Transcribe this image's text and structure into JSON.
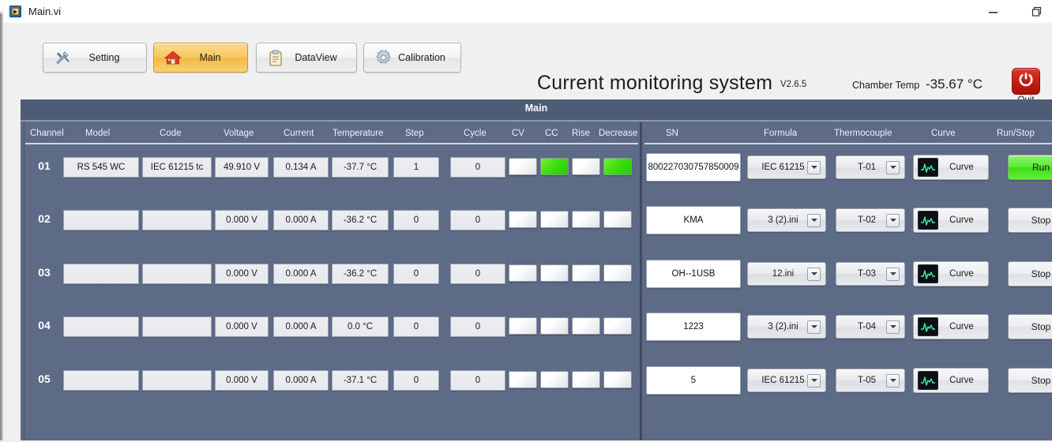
{
  "window": {
    "title": "Main.vi",
    "icon": "labview-vi-icon",
    "controls": [
      {
        "name": "minimize-button",
        "glyph": "minimize-icon"
      },
      {
        "name": "restore-button",
        "glyph": "restore-icon"
      }
    ]
  },
  "toolbar": {
    "buttons": [
      {
        "id": "setting",
        "label": "Setting",
        "icon": "tools-icon",
        "active": false
      },
      {
        "id": "main",
        "label": "Main",
        "icon": "home-icon",
        "active": true
      },
      {
        "id": "dataview",
        "label": "DataView",
        "icon": "clipboard-icon",
        "active": false
      },
      {
        "id": "calibration",
        "label": "Calibration",
        "icon": "gear-icon",
        "active": false
      }
    ],
    "app_title": "Current monitoring system",
    "version": "V2.6.5",
    "chamber_temp_label": "Chamber Temp",
    "chamber_temp_value": "-35.67 °C",
    "quit_label": "Quit",
    "quit_icon": "power-icon",
    "quit_color": "#c21d12",
    "accent_color": "#f4ba42"
  },
  "panel": {
    "header": "Main",
    "left_headers": [
      "Channel",
      "Model",
      "Code",
      "Voltage",
      "Current",
      "Temperature",
      "Step",
      "Cycle",
      "CV",
      "CC",
      "Rise",
      "Decrease"
    ],
    "right_headers": [
      "SN",
      "Formula",
      "Thermocouple",
      "Curve",
      "Run/Stop"
    ],
    "lamp_on_color": "#3fdd15",
    "lamp_off_color": "#ffffff",
    "rows": [
      {
        "channel": "01",
        "model": "RS 545 WC",
        "code": "IEC 61215 tc",
        "voltage": "49.910 V",
        "current": "0.134 A",
        "temperature": "-37.7 °C",
        "step": "1",
        "cycle": "0",
        "cv": false,
        "cc": true,
        "rise": false,
        "decrease": true,
        "sn": "800227030757850009",
        "formula": "IEC 61215",
        "thermocouple": "T-01",
        "curve_label": "Curve",
        "run_stop": "Run",
        "running": true
      },
      {
        "channel": "02",
        "model": "",
        "code": "",
        "voltage": "0.000 V",
        "current": "0.000 A",
        "temperature": "-36.2 °C",
        "step": "0",
        "cycle": "0",
        "cv": false,
        "cc": false,
        "rise": false,
        "decrease": false,
        "sn": "KMA",
        "formula": "3 (2).ini",
        "thermocouple": "T-02",
        "curve_label": "Curve",
        "run_stop": "Stop",
        "running": false
      },
      {
        "channel": "03",
        "model": "",
        "code": "",
        "voltage": "0.000 V",
        "current": "0.000 A",
        "temperature": "-36.2 °C",
        "step": "0",
        "cycle": "0",
        "cv": false,
        "cc": false,
        "rise": false,
        "decrease": false,
        "sn": "OH--1USB",
        "formula": "12.ini",
        "thermocouple": "T-03",
        "curve_label": "Curve",
        "run_stop": "Stop",
        "running": false
      },
      {
        "channel": "04",
        "model": "",
        "code": "",
        "voltage": "0.000 V",
        "current": "0.000 A",
        "temperature": "0.0 °C",
        "step": "0",
        "cycle": "0",
        "cv": false,
        "cc": false,
        "rise": false,
        "decrease": false,
        "sn": "1223",
        "formula": "3 (2).ini",
        "thermocouple": "T-04",
        "curve_label": "Curve",
        "run_stop": "Stop",
        "running": false
      },
      {
        "channel": "05",
        "model": "",
        "code": "",
        "voltage": "0.000 V",
        "current": "0.000 A",
        "temperature": "-37.1 °C",
        "step": "0",
        "cycle": "0",
        "cv": false,
        "cc": false,
        "rise": false,
        "decrease": false,
        "sn": "5",
        "formula": "IEC 61215",
        "thermocouple": "T-05",
        "curve_label": "Curve",
        "run_stop": "Stop",
        "running": false
      }
    ]
  }
}
